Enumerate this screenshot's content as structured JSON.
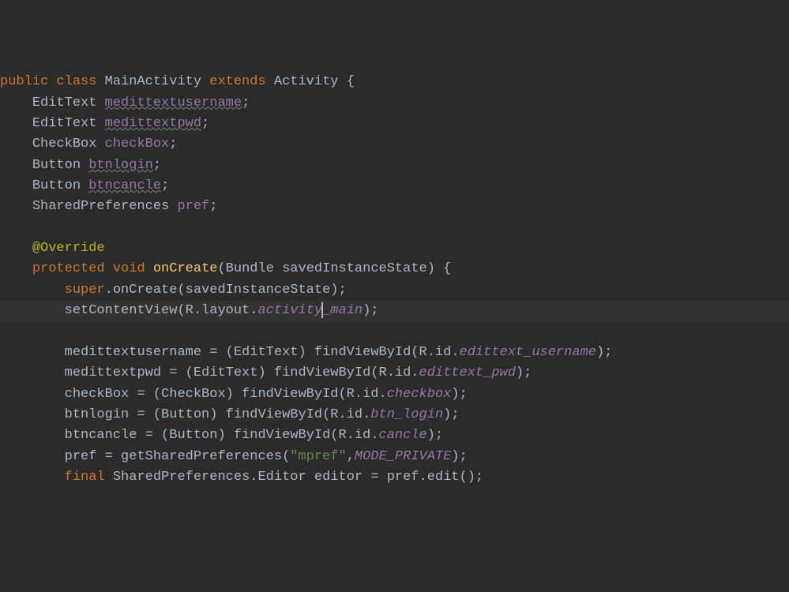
{
  "code": {
    "line0": {
      "kw1": "public class",
      "name": "MainActivity",
      "kw2": "extends",
      "parent": "Activity",
      "brace": "{"
    },
    "line1": {
      "type": "EditText",
      "field": "medittextusername",
      "semi": ";"
    },
    "line2": {
      "type": "EditText",
      "field": "medittextpwd",
      "semi": ";"
    },
    "line3": {
      "type": "CheckBox",
      "field": "checkBox",
      "semi": ";"
    },
    "line4": {
      "type": "Button",
      "field": "btnlogin",
      "semi": ";"
    },
    "line5": {
      "type": "Button",
      "field": "btncancle",
      "semi": ";"
    },
    "line6": {
      "type": "SharedPreferences",
      "field": "pref",
      "semi": ";"
    },
    "line8": {
      "annotation": "@Override"
    },
    "line9": {
      "mod": "protected",
      "ret": "void",
      "name": "onCreate",
      "lp": "(",
      "ptype": "Bundle",
      "pname": "savedInstanceState",
      "rp": ")",
      "brace": " {"
    },
    "line10": {
      "obj": "super",
      "dot": ".",
      "call": "onCreate(savedInstanceState);"
    },
    "line11": {
      "call": "setContentView(R.layout.",
      "res1": "activity",
      "res2": "_main",
      "end": ");"
    },
    "line13": {
      "lhs": "medittextusername = (EditText) findViewById(R.id.",
      "res": "edittext_username",
      "end": ");"
    },
    "line14": {
      "lhs": "medittextpwd = (EditText) findViewById(R.id.",
      "res": "edittext_pwd",
      "end": ");"
    },
    "line15": {
      "lhs": "checkBox = (CheckBox) findViewById(R.id.",
      "res": "checkbox",
      "end": ");"
    },
    "line16": {
      "lhs": "btnlogin = (Button) findViewById(R.id.",
      "res": "btn_login",
      "end": ");"
    },
    "line17": {
      "lhs": "btncancle = (Button) findViewById(R.id.",
      "res": "cancle",
      "end": ");"
    },
    "line18": {
      "lhs": "pref = getSharedPreferences(",
      "str": "\"mpref\"",
      "comma": ",",
      "const": "MODE_PRIVATE",
      "end": ");"
    },
    "line19": {
      "kw": "final",
      "rest": " SharedPreferences.Editor editor = pref.edit();"
    }
  }
}
